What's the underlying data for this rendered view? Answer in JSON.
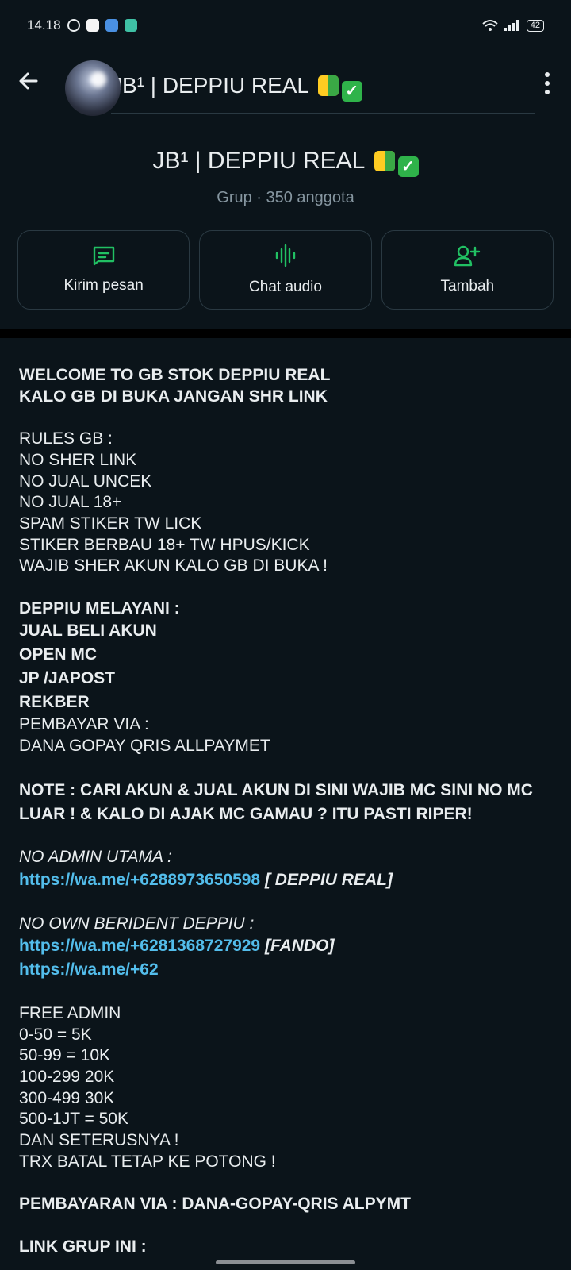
{
  "status_bar": {
    "time": "14.18",
    "battery": "42"
  },
  "top_bar": {
    "title": "JB¹ | DEPPIU REAL",
    "badges": [
      "shield-badge",
      "check-badge"
    ]
  },
  "group_header": {
    "title": "JB¹ | DEPPIU REAL",
    "subtitle": "Grup · 350 anggota"
  },
  "actions": [
    {
      "label": "Kirim pesan",
      "icon": "message-icon"
    },
    {
      "label": "Chat audio",
      "icon": "audio-wave-icon"
    },
    {
      "label": "Tambah",
      "icon": "add-person-icon"
    }
  ],
  "description": {
    "intro": [
      "WELCOME TO GB STOK DEPPIU REAL",
      "KALO GB DI BUKA JANGAN SHR LINK"
    ],
    "rules": [
      "RULES GB :",
      "NO SHER LINK",
      "NO JUAL UNCEK",
      "NO JUAL 18+",
      "SPAM STIKER TW LICK",
      "STIKER BERBAU 18+ TW HPUS/KICK",
      "WAJIB SHER AKUN KALO GB DI BUKA !"
    ],
    "services_title": "DEPPIU MELAYANI :",
    "services": [
      "JUAL BELI AKUN",
      "OPEN MC",
      "JP /JAPOST",
      "REKBER"
    ],
    "payment": [
      "PEMBAYAR VIA :",
      "DANA GOPAY QRIS ALLPAYMET"
    ],
    "note": [
      "NOTE : CARI AKUN & JUAL AKUN DI SINI WAJIB MC SINI NO MC",
      "LUAR ! & KALO DI AJAK MC GAMAU ? ITU PASTI RIPER!"
    ],
    "admin_title": "NO ADMIN UTAMA :",
    "admin_link": "https://wa.me/+6288973650598",
    "admin_name": " [ DEPPIU REAL]",
    "own_title": "NO OWN BERIDENT DEPPIU :",
    "own_link1": "https://wa.me/+6281368727929",
    "own_name1": " [FANDO]",
    "own_link2": "https://wa.me/+62",
    "fees": [
      "FREE ADMIN",
      "0-50 = 5K",
      "50-99 = 10K",
      "100-299 20K",
      "300-499 30K",
      "500-1JT = 50K",
      "DAN SETERUSNYA !",
      "TRX BATAL TETAP KE POTONG !"
    ],
    "payment_via": "PEMBAYARAN VIA : DANA-GOPAY-QRIS ALPYMT",
    "link_group": "LINK GRUP INI :"
  }
}
